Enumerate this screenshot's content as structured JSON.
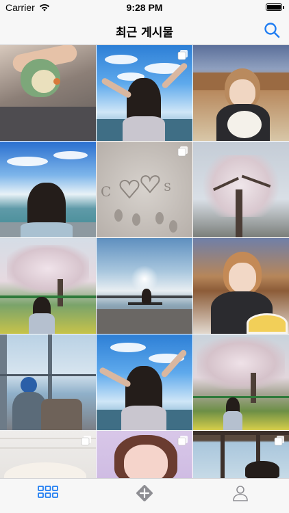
{
  "status_bar": {
    "carrier": "Carrier",
    "time": "9:28 PM",
    "battery_level": 1.0
  },
  "nav": {
    "title": "최근 게시물",
    "search_icon": "search-icon",
    "accent_color": "#1e7cf2"
  },
  "grid": {
    "columns": 3,
    "items": [
      {
        "subject": "bird on hand",
        "multi": false
      },
      {
        "subject": "beach arms up",
        "multi": true
      },
      {
        "subject": "girl cafe",
        "multi": false
      },
      {
        "subject": "sea view back",
        "multi": false
      },
      {
        "subject": "sand heart",
        "multi": true
      },
      {
        "subject": "cherry tree",
        "multi": false
      },
      {
        "subject": "cherry field girl",
        "multi": false
      },
      {
        "subject": "bench sky",
        "multi": false
      },
      {
        "subject": "girl eating",
        "multi": false
      },
      {
        "subject": "window balcony",
        "multi": false
      },
      {
        "subject": "beach arms up 2",
        "multi": false
      },
      {
        "subject": "cherry field",
        "multi": false
      },
      {
        "subject": "cat",
        "multi": true
      },
      {
        "subject": "selfie",
        "multi": true
      },
      {
        "subject": "cafe window",
        "multi": true
      }
    ]
  },
  "tab_bar": {
    "items": [
      {
        "icon": "grid-icon",
        "selected": true
      },
      {
        "icon": "add-icon",
        "selected": false
      },
      {
        "icon": "profile-icon",
        "selected": false
      }
    ],
    "selected_color": "#1e7cf2",
    "unselected_color": "#8e8e93"
  }
}
